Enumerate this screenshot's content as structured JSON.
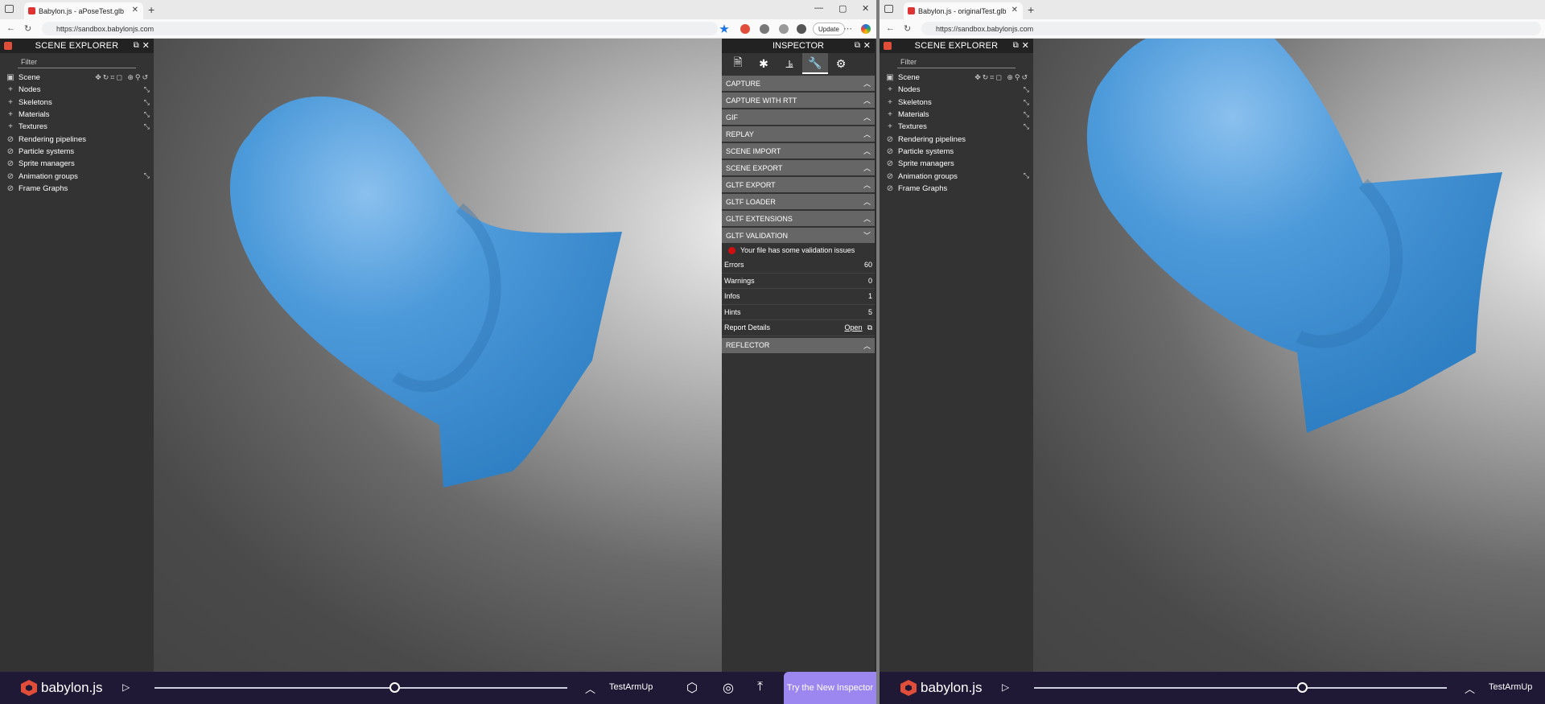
{
  "left": {
    "tab_title": "Babylon.js - aPoseTest.glb",
    "url": "https://sandbox.babylonjs.com",
    "update_label": "Update",
    "scene_explorer": {
      "title": "SCENE EXPLORER",
      "filter_placeholder": "Filter",
      "scene_label": "Scene",
      "items": [
        {
          "label": "Nodes",
          "icon": "plus-icon"
        },
        {
          "label": "Skeletons",
          "icon": "plus-icon"
        },
        {
          "label": "Materials",
          "icon": "plus-icon"
        },
        {
          "label": "Textures",
          "icon": "plus-icon"
        },
        {
          "label": "Rendering pipelines",
          "icon": "ban-icon"
        },
        {
          "label": "Particle systems",
          "icon": "ban-icon"
        },
        {
          "label": "Sprite managers",
          "icon": "ban-icon"
        },
        {
          "label": "Animation groups",
          "icon": "ban-icon"
        },
        {
          "label": "Frame Graphs",
          "icon": "ban-icon"
        }
      ]
    },
    "inspector": {
      "title": "INSPECTOR",
      "sections": [
        "CAPTURE",
        "CAPTURE WITH RTT",
        "GIF",
        "REPLAY",
        "SCENE IMPORT",
        "SCENE EXPORT",
        "GLTF EXPORT",
        "GLTF LOADER",
        "GLTF EXTENSIONS",
        "GLTF VALIDATION"
      ],
      "validation_message": "Your file has some validation issues",
      "stats": [
        {
          "label": "Errors",
          "value": "60"
        },
        {
          "label": "Warnings",
          "value": "0"
        },
        {
          "label": "Infos",
          "value": "1"
        },
        {
          "label": "Hints",
          "value": "5"
        }
      ],
      "report_label": "Report Details",
      "report_link": "Open",
      "reflector": "REFLECTOR"
    },
    "footer": {
      "brand": "babylon.js",
      "animation": "TestArmUp",
      "slider_fraction": 0.58,
      "try_label": "Try the New Inspector"
    }
  },
  "right": {
    "tab_title": "Babylon.js - originalTest.glb",
    "url": "https://sandbox.babylonjs.com",
    "scene_explorer": {
      "title": "SCENE EXPLORER",
      "filter_placeholder": "Filter",
      "scene_label": "Scene",
      "items": [
        {
          "label": "Nodes"
        },
        {
          "label": "Skeletons"
        },
        {
          "label": "Materials"
        },
        {
          "label": "Textures"
        },
        {
          "label": "Rendering pipelines"
        },
        {
          "label": "Particle systems"
        },
        {
          "label": "Sprite managers"
        },
        {
          "label": "Animation groups"
        },
        {
          "label": "Frame Graphs"
        }
      ]
    },
    "footer": {
      "brand": "babylon.js",
      "animation": "TestArmUp",
      "slider_fraction": 0.65
    }
  },
  "colors": {
    "mesh": "#3d8fd6",
    "footer_bg": "#201936",
    "accent": "#9b87ef",
    "error": "#d01010"
  }
}
